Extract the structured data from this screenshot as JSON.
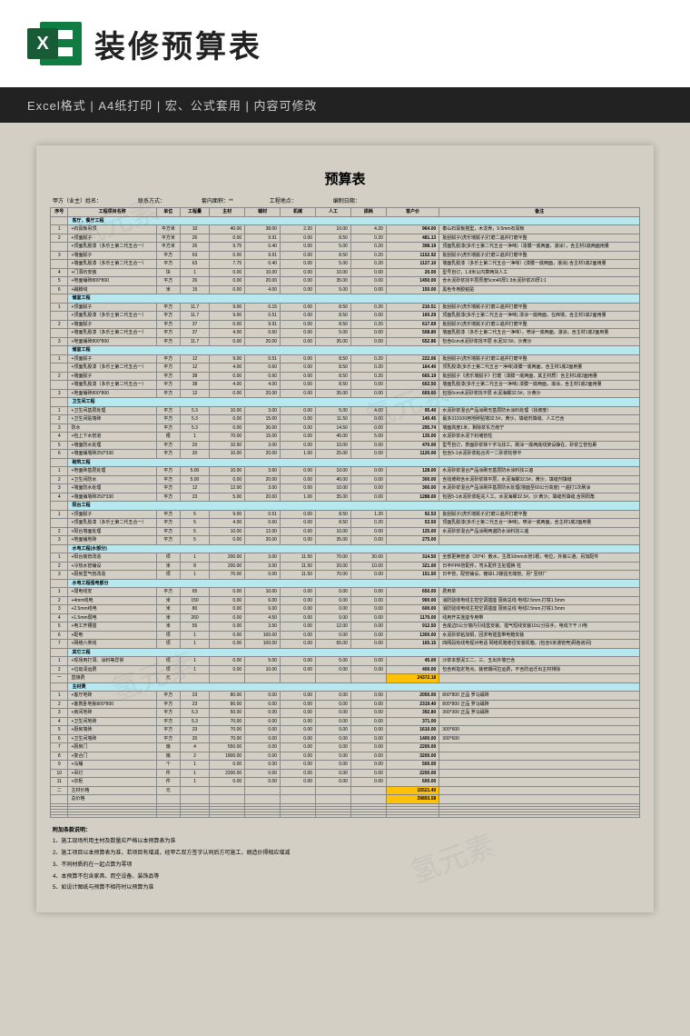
{
  "header": {
    "title": "装修预算表",
    "sub": "Excel格式 | A4纸打印 | 宏、公式套用 | 内容可修改",
    "icon": "X"
  },
  "doc": {
    "title": "预算表",
    "meta1": "甲方（业主）姓名：",
    "meta2": "联系方式：",
    "meta3": "套内面积：**",
    "meta4": "工程地点：",
    "meta5": "编制日期："
  },
  "cols": [
    "序号",
    "工程项目名称",
    "单位",
    "工程量",
    "主材",
    "辅材",
    "机械",
    "人工",
    "损耗",
    "客户价",
    "备注"
  ],
  "sections": [
    {
      "name": "客厅、餐厅工程",
      "rows": [
        {
          "n": "1",
          "item": "+石膏板吊顶",
          "u": "平方米",
          "q": "10",
          "c1": "40.00",
          "c2": "38.00",
          "c3": "2.20",
          "c4": "10.00",
          "c5": "4.20",
          "cost": "964.00",
          "note": "泰山石膏板搭型，木龙骨，9.5mm石膏板"
        },
        {
          "n": "2",
          "item": "+顶面腻子",
          "u": "平方米",
          "q": "26",
          "c1": "0.00",
          "c2": "9.91",
          "c3": "0.00",
          "c4": "8.50",
          "c5": "0.20",
          "cost": "481.13",
          "note": "批刮腻子(虎乐墙腻子)打磨二遍并打磨平整"
        },
        {
          "n": "",
          "item": "+顶面乳胶漆（多乐士第二代五合一）",
          "u": "平方米",
          "q": "26",
          "c1": "9.75",
          "c2": "0.40",
          "c3": "0.00",
          "c4": "5.00",
          "c5": "0.20",
          "cost": "398.19",
          "note": "顶面乳胶漆(多乐士第二代五合一净味)（漆膜一底两面、滚涂），含主材1底两面用量"
        },
        {
          "n": "3",
          "item": "+墙面腻子",
          "u": "平方",
          "q": "63",
          "c1": "0.00",
          "c2": "9.91",
          "c3": "0.00",
          "c4": "8.50",
          "c5": "0.20",
          "cost": "1152.92",
          "note": "批刮腻子(虎乐墙腻子)打磨三遍并打磨平整"
        },
        {
          "n": "",
          "item": "+墙面乳胶漆（多乐士第二代五合一）",
          "u": "平方",
          "q": "63",
          "c1": "7.75",
          "c2": "0.40",
          "c3": "0.00",
          "c4": "5.00",
          "c5": "0.20",
          "cost": "1127.10",
          "note": "墙面乳胶漆（多乐士第二代五合一净味）(漆膜一底两面，滚涂) 含主材1底2面用量"
        },
        {
          "n": "4",
          "item": "+门洞石安装",
          "u": "块",
          "q": "1",
          "c1": "0.00",
          "c2": "10.00",
          "c3": "0.00",
          "c4": "10.00",
          "c5": "0.00",
          "cost": "20.00",
          "note": "型号自订，1.8米以内算两块人工"
        },
        {
          "n": "5",
          "item": "+地面铺砖800*800",
          "u": "平方",
          "q": "26",
          "c1": "0.00",
          "c2": "20.00",
          "c3": "0.00",
          "c4": "35.00",
          "c5": "0.00",
          "cost": "1450.00",
          "note": "含水泥砂浆找平层厚度5cm40厚1:3水泥砂浆20厚1:1",
          "note2": ""
        },
        {
          "n": "6",
          "item": "+踢脚线",
          "u": "米",
          "q": "15",
          "c1": "0.00",
          "c2": "4.00",
          "c3": "0.00",
          "c4": "5.00",
          "c5": "0.00",
          "cost": "150.00",
          "note": "黑色专用胶粘贴"
        }
      ]
    },
    {
      "name": "储室工程",
      "rows": [
        {
          "n": "1",
          "item": "+顶面腻子",
          "u": "平方",
          "q": "11.7",
          "c1": "9.00",
          "c2": "0.15",
          "c3": "0.00",
          "c4": "8.50",
          "c5": "0.20",
          "cost": "210.51",
          "note": "批刮腻子(虎乐墙腻子)打磨三遍并打磨平整"
        },
        {
          "n": "",
          "item": "+顶面乳胶漆（多乐士第二代五合一）",
          "u": "平方",
          "q": "11.7",
          "c1": "9.00",
          "c2": "0.51",
          "c3": "0.00",
          "c4": "8.50",
          "c5": "0.00",
          "cost": "160.29",
          "note": "顶面乳胶漆(多乐士第二代五合一净味) 漆涂一底两面，在西墙，含主材1底2面用量"
        },
        {
          "n": "2",
          "item": "+墙面腻子",
          "u": "平方",
          "q": "37",
          "c1": "0.00",
          "c2": "9.91",
          "c3": "0.00",
          "c4": "8.50",
          "c5": "0.20",
          "cost": "617.69",
          "note": "批刮腻子(虎乐墙腻子)打磨三遍并打磨平整"
        },
        {
          "n": "",
          "item": "+墙面乳胶漆（多乐士第二代五合一）",
          "u": "平方",
          "q": "37",
          "c1": "4.00",
          "c2": "0.60",
          "c3": "0.00",
          "c4": "5.00",
          "c5": "0.00",
          "cost": "508.80",
          "note": "墙面乳胶漆（多乐士第二代五合一净味），喷涂一底两面。滚涂，含主材1底2面用量"
        },
        {
          "n": "3",
          "item": "+地面铺砖800*800",
          "u": "平方",
          "q": "11.7",
          "c1": "0.00",
          "c2": "20.00",
          "c3": "0.00",
          "c4": "35.00",
          "c5": "0.00",
          "cost": "652.86",
          "note": "包含6cm水泥砂浆找平层 水泥32.5#，沙黄沙"
        }
      ]
    },
    {
      "name": "储室工程",
      "rows": [
        {
          "n": "1",
          "item": "+顶面腻子",
          "u": "平方",
          "q": "12",
          "c1": "9.00",
          "c2": "0.51",
          "c3": "0.00",
          "c4": "8.50",
          "c5": "0.20",
          "cost": "222.06",
          "note": "批刮腻子(虎乐墙腻子)打磨三遍并打磨平整"
        },
        {
          "n": "",
          "item": "+顶面乳胶漆（多乐士第二代五合一）",
          "u": "平方",
          "q": "12",
          "c1": "4.00",
          "c2": "0.60",
          "c3": "0.00",
          "c4": "8.50",
          "c5": "0.20",
          "cost": "164.40",
          "note": "顶乳胶漆(多乐士第二代五合一净味)漆膜一底两面，含主材1底2面用量"
        },
        {
          "n": "2",
          "item": "+墙面腻子",
          "u": "平方",
          "q": "38",
          "c1": "0.00",
          "c2": "0.60",
          "c3": "0.00",
          "c4": "8.50",
          "c5": "0.20",
          "cost": "665.19",
          "note": "批刮腻子《虎乐墙腻子》打磨（漆膜一底两面，其主材质）含主材1底2面用量"
        },
        {
          "n": "",
          "item": "+墙面乳胶漆（多乐士第二代五合一）",
          "u": "平方",
          "q": "38",
          "c1": "4.00",
          "c2": "4.00",
          "c3": "0.00",
          "c4": "8.50",
          "c5": "0.00",
          "cost": "602.50",
          "note": "墙面乳胶漆(多乐士第二代五合一净味) 漆膜一底两面，滚涂，含主材1底2面用量"
        },
        {
          "n": "3",
          "item": "+地面铺砖800*800",
          "u": "平方",
          "q": "12",
          "c1": "0.00",
          "c2": "20.00",
          "c3": "0.00",
          "c4": "35.00",
          "c5": "0.00",
          "cost": "669.60",
          "note": "包括6cm水泥砂浆找平层 水泥海螺32.5#，沙黄沙"
        }
      ]
    },
    {
      "name": "卫生间工程",
      "rows": [
        {
          "n": "1",
          "item": "+卫生间基层处理",
          "u": "平方",
          "q": "5.3",
          "c1": "10.00",
          "c2": "3.00",
          "c3": "0.00",
          "c4": "5.00",
          "c5": "4.00",
          "cost": "95.40",
          "note": "水泥砂浆混合产品涂刷无基层防水涂料处理（找坡度）"
        },
        {
          "n": "2",
          "item": "+卫生间贴墙砖",
          "u": "平方",
          "q": "5.3",
          "c1": "0.00",
          "c2": "15.00",
          "c3": "0.00",
          "c4": "11.50",
          "c5": "0.00",
          "cost": "140.45",
          "note": "最多319100用地砖贴墙32.5#，黄沙，填缝剂填缝。人工已含"
        },
        {
          "n": "3",
          "item": "防水",
          "u": "平方",
          "q": "5.3",
          "c1": "0.00",
          "c2": "30.00",
          "c3": "0.00",
          "c4": "14.50",
          "c5": "0.00",
          "cost": "295.74",
          "note": "墙面高度1米，剩除浆东方南宁"
        },
        {
          "n": "4",
          "item": "+包上下水管道",
          "u": "根",
          "q": "1",
          "c1": "70.00",
          "c2": "15.00",
          "c3": "0.00",
          "c4": "45.00",
          "c5": "5.00",
          "cost": "135.00",
          "note": "水泥砂浆水泥下封堵管柱"
        },
        {
          "n": "5",
          "item": "+墙面防水处理",
          "u": "平方",
          "q": "20",
          "c1": "10.50",
          "c2": "3.00",
          "c3": "0.00",
          "c4": "10.00",
          "c5": "0.00",
          "cost": "470.00",
          "note": "型号自订，表面砂浆抹十字马找工。刷涂一底两底线架设静在，砂浆立管包裹"
        },
        {
          "n": "6",
          "item": "+墙面铺墙砖250*330",
          "u": "平方",
          "q": "20",
          "c1": "10.00",
          "c2": "20.00",
          "c3": "1.00",
          "c4": "25.00",
          "c5": "0.00",
          "cost": "1120.00",
          "note": "包含5-1水泥砂浆粘合共一二砂浆轮修平"
        }
      ]
    },
    {
      "name": "砌筑工程",
      "rows": [
        {
          "n": "1",
          "item": "+地面砖基层处理",
          "u": "平方",
          "q": "5.00",
          "c1": "10.00",
          "c2": "3.60",
          "c3": "0.00",
          "c4": "10.00",
          "c5": "0.00",
          "cost": "128.00",
          "note": "水泥砂浆混合产品涂刷无基层防水涂料找三遍"
        },
        {
          "n": "2",
          "item": "+卫生间防水",
          "u": "平方",
          "q": "5.00",
          "c1": "0.00",
          "c2": "20.00",
          "c3": "0.00",
          "c4": "40.00",
          "c5": "0.00",
          "cost": "300.00",
          "note": "含找坡和含水泥砂浆抹平层，水泥海螺32.5#，黄沙，填缝剂填缝"
        },
        {
          "n": "3",
          "item": "+墙面防水处理",
          "u": "平方",
          "q": "12",
          "c1": "12.00",
          "c2": "3.00",
          "c3": "0.00",
          "c4": "10.00",
          "c5": "0.00",
          "cost": "300.00",
          "note": "水泥砂浆混合产品涂刷并基层防水处理(墙面至60公分高度) 一遍打1次刷涂"
        },
        {
          "n": "4",
          "item": "+墙面铺墙砖250*330",
          "u": "平方",
          "q": "23",
          "c1": "5.00",
          "c2": "20.00",
          "c3": "1.00",
          "c4": "35.00",
          "c5": "0.00",
          "cost": "1288.00",
          "note": "包括5-1水泥砂浆粘充人工。水泥海螺32.5#。沙:黄沙；填缝剂填缝,含阴阳角"
        }
      ]
    },
    {
      "name": "阳台工程",
      "rows": [
        {
          "n": "1",
          "item": "+顶面腻子",
          "u": "平方",
          "q": "5",
          "c1": "9.00",
          "c2": "0.51",
          "c3": "0.00",
          "c4": "8.50",
          "c5": "1.20",
          "cost": "92.53",
          "note": "批刮腻子(虎乐墙腻子)打磨三遍并打磨平整"
        },
        {
          "n": "",
          "item": "+顶面乳胶漆（多乐士第二代五合一）",
          "u": "平方",
          "q": "5",
          "c1": "4.00",
          "c2": "0.60",
          "c3": "0.00",
          "c4": "8.50",
          "c5": "0.20",
          "cost": "53.50",
          "note": "顶面乳胶漆(多乐士第二代五合一净味)，喷涂一底两面。含主材1底2面用量"
        },
        {
          "n": "2",
          "item": "+阳台墙面处理",
          "u": "平方",
          "q": "5",
          "c1": "10.00",
          "c2": "12.00",
          "c3": "0.00",
          "c4": "10.00",
          "c5": "0.00",
          "cost": "125.00",
          "note": "水泥砂浆混合产品涂刷两遍防水涂料找三遍"
        },
        {
          "n": "3",
          "item": "+地面铺地砖",
          "u": "平方",
          "q": "5",
          "c1": "0.00",
          "c2": "20.00",
          "c3": "0.00",
          "c4": "35.00",
          "c5": "0.00",
          "cost": "275.00",
          "note": ""
        }
      ]
    },
    {
      "name": "水电工程(水部分)",
      "rows": [
        {
          "n": "1",
          "item": "+阳台装管改造",
          "u": "项",
          "q": "1",
          "c1": "200.00",
          "c2": "3.00",
          "c3": "11.50",
          "c4": "70.00",
          "c5": "30.00",
          "cost": "314.50",
          "note": "全部更换管道（20*4）散水，主改10mm水管1根，电位，外接三通。另加配件"
        },
        {
          "n": "2",
          "item": "+冷热水管铺设",
          "u": "米",
          "q": "8",
          "c1": "200.00",
          "c2": "3.00",
          "c3": "11.50",
          "c4": "20.00",
          "c5": "10.00",
          "cost": "321.00",
          "note": "日丰PPR管配件，弯头配件主处理换 柱"
        },
        {
          "n": "3",
          "item": "+厨房里气管改造",
          "u": "项",
          "q": "1",
          "c1": "70.00",
          "c2": "0.00",
          "c3": "11.50",
          "c4": "70.00",
          "c5": "0.00",
          "cost": "151.50",
          "note": "日丰管，配管铺设，镀锌1.2镂强无端管。另* 至材厂"
        }
      ]
    },
    {
      "name": "水电工程强电部分",
      "rows": [
        {
          "n": "1",
          "item": "+弱电线安",
          "u": "平方",
          "q": "65",
          "c1": "0.00",
          "c2": "10.00",
          "c3": "0.00",
          "c4": "0.00",
          "c5": "0.00",
          "cost": "650.00",
          "note": "费用单"
        },
        {
          "n": "2",
          "item": "+4mm线电",
          "u": "米",
          "q": "150",
          "c1": "0.00",
          "c2": "6.00",
          "c3": "0.00",
          "c4": "0.00",
          "c5": "0.00",
          "cost": "900.00",
          "note": "消防验收电线主控空调插座 厨房总线 电线2.5mm,打铁1.5mm"
        },
        {
          "n": "3",
          "item": "+2.5mm线电",
          "u": "米",
          "q": "80",
          "c1": "0.00",
          "c2": "6.00",
          "c3": "0.00",
          "c4": "0.00",
          "c5": "0.00",
          "cost": "600.00",
          "note": "消防验收电线主控空调插座 厨房总线 电线2.5mm,打铁1.5mm"
        },
        {
          "n": "4",
          "item": "+1.5mm弱电",
          "u": "米",
          "q": "260",
          "c1": "0.00",
          "c2": "4.50",
          "c3": "0.00",
          "c4": "0.00",
          "c5": "0.00",
          "cost": "1170.00",
          "note": "线用开关连座专用带"
        },
        {
          "n": "5",
          "item": "+电工开槽插",
          "u": "米",
          "q": "55",
          "c1": "0.00",
          "c2": "3.50",
          "c3": "0.00",
          "c4": "12.00",
          "c5": "0.00",
          "cost": "912.50",
          "note": "含底边5公分墙内引线盒安装、插气短线安装10公分扶手，电线下干 川电"
        },
        {
          "n": "6",
          "item": "+配电",
          "u": "项",
          "q": "1",
          "c1": "0.00",
          "c2": "100.00",
          "c3": "0.00",
          "c4": "0.00",
          "c5": "0.00",
          "cost": "1300.00",
          "note": "水泥砂浆粘加铜，回求电插盒带电箱安装"
        },
        {
          "n": "7",
          "item": "+网络六类线",
          "u": "项",
          "q": "1",
          "c1": "0.00",
          "c2": "100.00",
          "c3": "0.00",
          "c4": "65.00",
          "c5": "0.00",
          "cost": "165.15",
          "note": "四网段有线电视对电话 网络机箱卷径安装机箱，(包含5米通管壳)网各房间)"
        }
      ]
    },
    {
      "name": "其它工程",
      "rows": [
        {
          "n": "1",
          "item": "+现场用打洞、涂料等异常",
          "u": "项",
          "q": "1",
          "c1": "0.00",
          "c2": "5.00",
          "c3": "0.00",
          "c4": "5.00",
          "c5": "0.00",
          "cost": "45.00",
          "note": "沙浆本部泥工二、三、五出外墙已含"
        },
        {
          "n": "2",
          "item": "+垃圾清运费",
          "u": "项",
          "q": "1",
          "c1": "0.00",
          "c2": "10.00",
          "c3": "0.00",
          "c4": "0.00",
          "c5": "0.00",
          "cost": "400.00",
          "note": "包含到指定地点。装修期间拉运费，不含防运迁出主材排除"
        }
      ]
    }
  ],
  "subtotals": {
    "direct": "直接费",
    "directval": "24372.18",
    "main": "主材费",
    "main_rows": [
      {
        "n": "1",
        "item": "+客厅地砖",
        "u": "平方",
        "q": "23",
        "c1": "80.00",
        "cost": "2050.00",
        "note": "800*800 正品 罗马磁砖"
      },
      {
        "n": "2",
        "item": "+客携卧地板800*800",
        "u": "平方",
        "q": "23",
        "c1": "80.00",
        "cost": "2319.40",
        "note": "800*800 正品 罗马磁砖"
      },
      {
        "n": "3",
        "item": "+房间地砖",
        "u": "平方",
        "q": "5.3",
        "c1": "50.00",
        "cost": "392.80",
        "note": "300*300 正品 罗马磁砖"
      },
      {
        "n": "4",
        "item": "+卫生间地砖",
        "u": "平方",
        "q": "5.3",
        "c1": "70.00",
        "cost": "371.00",
        "note": ""
      },
      {
        "n": "5",
        "item": "+厨房墙砖",
        "u": "平方",
        "q": "23",
        "c1": "70.00",
        "cost": "1610.00",
        "note": "300*600"
      },
      {
        "n": "6",
        "item": "+卫生间墙砖",
        "u": "平方",
        "q": "20",
        "c1": "70.00",
        "cost": "1400.00",
        "note": "300*600"
      },
      {
        "n": "7",
        "item": "+厨房门",
        "u": "扇",
        "q": "4",
        "c1": "550.00",
        "cost": "2200.00",
        "note": ""
      },
      {
        "n": "8",
        "item": "+复合门",
        "u": "扇",
        "q": "2",
        "c1": "1800.00",
        "cost": "3200.00",
        "note": ""
      },
      {
        "n": "9",
        "item": "+马桶",
        "u": "个",
        "q": "1",
        "cost": "500.00",
        "note": ""
      },
      {
        "n": "10",
        "item": "+吊灯",
        "u": "件",
        "q": "1",
        "c1": "2200.00",
        "cost": "2200.00",
        "note": ""
      },
      {
        "n": "11",
        "item": "+衣柜",
        "u": "件",
        "q": "1",
        "cost": "600.00",
        "note": ""
      }
    ],
    "mainlabel": "主材价格",
    "mainval": "15521.40",
    "total": "总价格",
    "totalval": "39893.58"
  },
  "notes": {
    "h": "附加条款说明：",
    "l1": "1、施工现场所用主材及数量应严格以本预算表为准",
    "l2": "2、施工项目以本预算表为准，若项目有增减，经甲乙双方签字认同后方可施工，胡造价得相应增减",
    "l3": "3、不同材质的在一起点算为零项",
    "l4": "4、本预算不包含家具、而空设备、装饰品等",
    "l5": "5、如设计图纸与预算不相符时以预算为准"
  }
}
